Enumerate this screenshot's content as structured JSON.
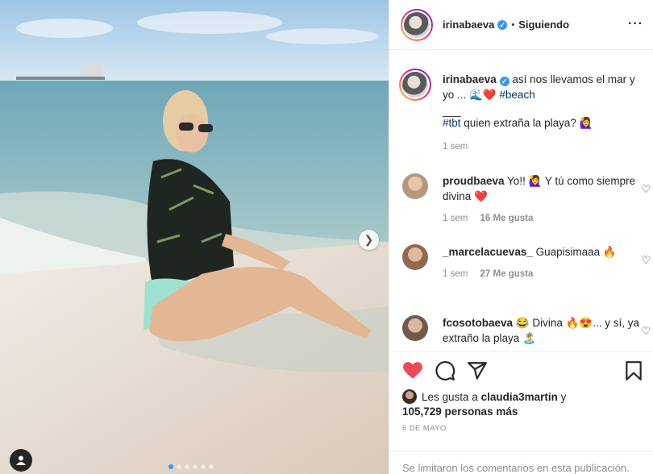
{
  "post": {
    "username": "irinabaeva",
    "verified_mark": "✓",
    "follow_separator": "•",
    "follow_status": "Siguiendo",
    "more_icon": "more-icon",
    "carousel": {
      "dots": 6,
      "active_index": 0
    }
  },
  "caption": {
    "username": "irinabaeva",
    "text_part1": "así nos llevamos el mar y yo ... 🌊❤️",
    "hashtag1": "#beach",
    "divider": "___",
    "hashtag2": "#tbt",
    "text_part2": "quien extraña la playa? 🙋‍♀️",
    "time": "1 sem"
  },
  "comments": [
    {
      "username": "proudbaeva",
      "text": "Yo!! 🙋‍♀️ Y tú como siempre divina ❤️",
      "time": "1 sem",
      "likes": "16 Me gusta"
    },
    {
      "username": "_marcelacuevas_",
      "text": "Guapisimaaa 🔥",
      "time": "1 sem",
      "likes": "27 Me gusta"
    },
    {
      "username": "fcosotobaeva",
      "text": "😂 Divina 🔥😍... y sí, ya extraño la playa 🏝️",
      "time": "",
      "likes": ""
    }
  ],
  "actions": {
    "like_icon": "heart-filled-icon",
    "comment_icon": "comment-icon",
    "share_icon": "share-icon",
    "save_icon": "bookmark-icon"
  },
  "likes": {
    "prefix": "Les gusta a",
    "user": "claudia3martin",
    "connector": "y",
    "others": "105,729 personas más"
  },
  "date": "6 DE MAYO",
  "comments_limited": "Se limitaron los comentarios en esta publicación.",
  "colors": {
    "like_red": "#ed4956",
    "link_blue": "#00376b",
    "verified_blue": "#3897f0",
    "muted": "#8e8e8e"
  }
}
